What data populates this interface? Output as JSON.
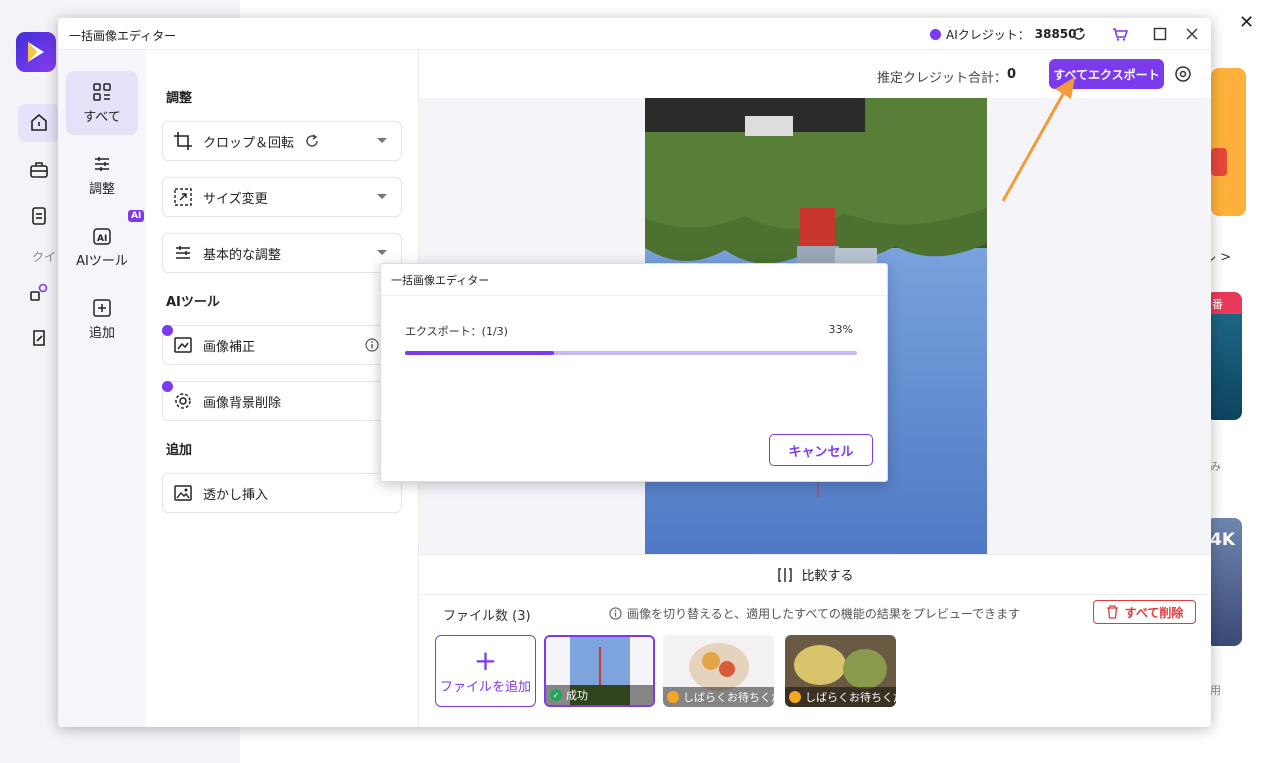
{
  "editor": {
    "title": "一括画像エディター",
    "credits_label": "AIクレジット：",
    "credits_value": "38850"
  },
  "tabs": [
    {
      "label": "すべて",
      "active": true
    },
    {
      "label": "調整"
    },
    {
      "label": "AIツール",
      "badge": "AI"
    },
    {
      "label": "追加"
    }
  ],
  "panel": {
    "section_adjust": "調整",
    "crop": "クロップ＆回転",
    "resize": "サイズ変更",
    "basic": "基本的な調整",
    "section_ai": "AIツール",
    "enhance": "画像補正",
    "bg_remove": "画像背景削除",
    "section_add": "追加",
    "watermark": "透かし挿入"
  },
  "preview": {
    "est_label": "推定クレジット合計：",
    "est_value": "0",
    "export_all": "すべてエクスポート",
    "compare": "比較する"
  },
  "files": {
    "count_label": "ファイル数 (3)",
    "hint": "画像を切り替えると、適用したすべての機能の結果をプレビューできます",
    "delete_all": "すべて削除",
    "add_file": "ファイルを追加",
    "items": [
      {
        "status": "成功"
      },
      {
        "status": "しばらくお待ちください"
      },
      {
        "status": "しばらくお待ちください"
      }
    ]
  },
  "dialog": {
    "title": "一括画像エディター",
    "progress_label": "エクスポート：(1/3)",
    "progress_pct": "33%",
    "progress": 0.33,
    "cancel": "キャンセル"
  },
  "background": {
    "quick_label": "クイ",
    "tool_link": "ル >",
    "card_badge": "番",
    "card_4k": "4K",
    "text_mi": "み",
    "text_you": "用"
  },
  "colors": {
    "accent": "#7c3aed",
    "danger": "#e23a3a",
    "arrow": "#f39a3a"
  }
}
